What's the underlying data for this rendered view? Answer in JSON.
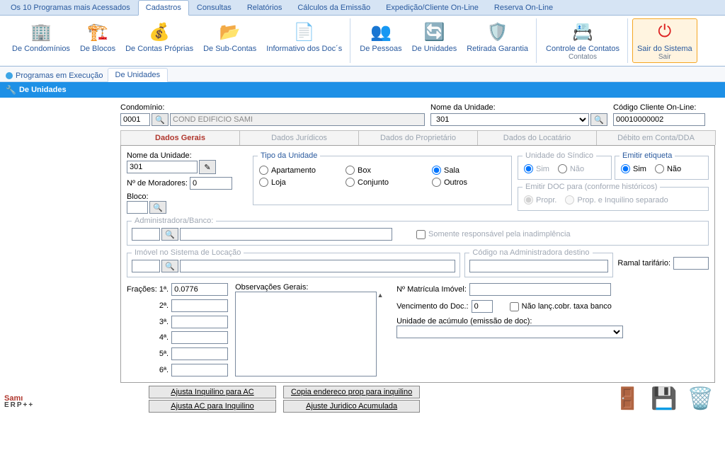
{
  "menu_tabs": [
    "Os 10 Programas mais Acessados",
    "Cadastros",
    "Consultas",
    "Relatórios",
    "Cálculos da Emissão",
    "Expedição/Cliente On-Line",
    "Reserva On-Line"
  ],
  "menu_active": 1,
  "ribbon": {
    "g1": [
      {
        "label": "De Condomínios",
        "icon": "🏢"
      },
      {
        "label": "De Blocos",
        "icon": "🏗️"
      },
      {
        "label": "De Contas Próprias",
        "icon": "💰"
      },
      {
        "label": "De Sub-Contas",
        "icon": "📂"
      },
      {
        "label": "Informativo dos Doc´s",
        "icon": "📄"
      }
    ],
    "g2": [
      {
        "label": "De Pessoas",
        "icon": "👥"
      },
      {
        "label": "De Unidades",
        "icon": "🔄"
      },
      {
        "label": "Retirada Garantia",
        "icon": "🛡️"
      }
    ],
    "g3": [
      {
        "label": "Controle de Contatos",
        "sub": "Contatos",
        "icon": "📇"
      }
    ],
    "g4": [
      {
        "label": "Sair do Sistema",
        "sub": "Sair",
        "icon": "⏻"
      }
    ]
  },
  "subtabs": {
    "prog": "Programas em Execução",
    "t1": "De Unidades"
  },
  "titlebar": "De Unidades",
  "top": {
    "condominio_label": "Condomínio:",
    "condominio_val": "0001",
    "condominio_name": "COND EDIFICIO SAMI",
    "nome_unidade_label": "Nome da Unidade:",
    "nome_unidade_val": "301",
    "codigo_label": "Código Cliente On-Line:",
    "codigo_val": "00010000002"
  },
  "form_tabs": [
    "Dados Gerais",
    "Dados Jurídicos",
    "Dados do Proprietário",
    "Dados do Locatário",
    "Débito em Conta/DDA"
  ],
  "form": {
    "nome_unidade_label": "Nome da Unidade:",
    "nome_unidade": "301",
    "moradores_label": "Nº de Moradores:",
    "moradores": "0",
    "bloco_label": "Bloco:",
    "tipo_unidade_legend": "Tipo da Unidade",
    "tipo_opts": [
      "Apartamento",
      "Box",
      "Sala",
      "Loja",
      "Conjunto",
      "Outros"
    ],
    "tipo_selected": "Sala",
    "unidade_sindico_legend": "Unidade do Síndico",
    "emitir_etiqueta_legend": "Emitir etiqueta",
    "sim": "Sim",
    "nao": "Não",
    "emitir_doc_legend": "Emitir DOC para (conforme históricos)",
    "emitir_doc_opt1": "Propr.",
    "emitir_doc_opt2": "Prop. e Inquilino separado",
    "admin_legend": "Administradora/Banco:",
    "somente": "Somente responsável pela inadimplência",
    "imovel_legend": "Imóvel no Sistema de Locação",
    "codigo_admin_legend": "Código na Administradora destino",
    "ramal_label": "Ramal tarifário:",
    "fracoes_label": "Frações:",
    "frac_labels": [
      "1ª.",
      "2ª.",
      "3ª.",
      "4ª.",
      "5ª.",
      "6ª."
    ],
    "frac1": "0.0776",
    "obs_label": "Observações Gerais:",
    "matricula_label": "Nº Matrícula Imóvel:",
    "venc_label": "Vencimento do Doc.:",
    "venc_val": "0",
    "nao_lanc": "Não lanç.cobr. taxa banco",
    "acumulo_label": "Unidade de acúmulo (emissão de doc):"
  },
  "buttons": {
    "b1": "Ajusta Inquilino para AC",
    "b2": "Ajusta AC para Inquilino",
    "b3": "Copia endereco prop para inquilino",
    "b4": "Ajuste Juridico Acumulada"
  },
  "logo": {
    "main": "Samı",
    "sub": "ERP++"
  }
}
